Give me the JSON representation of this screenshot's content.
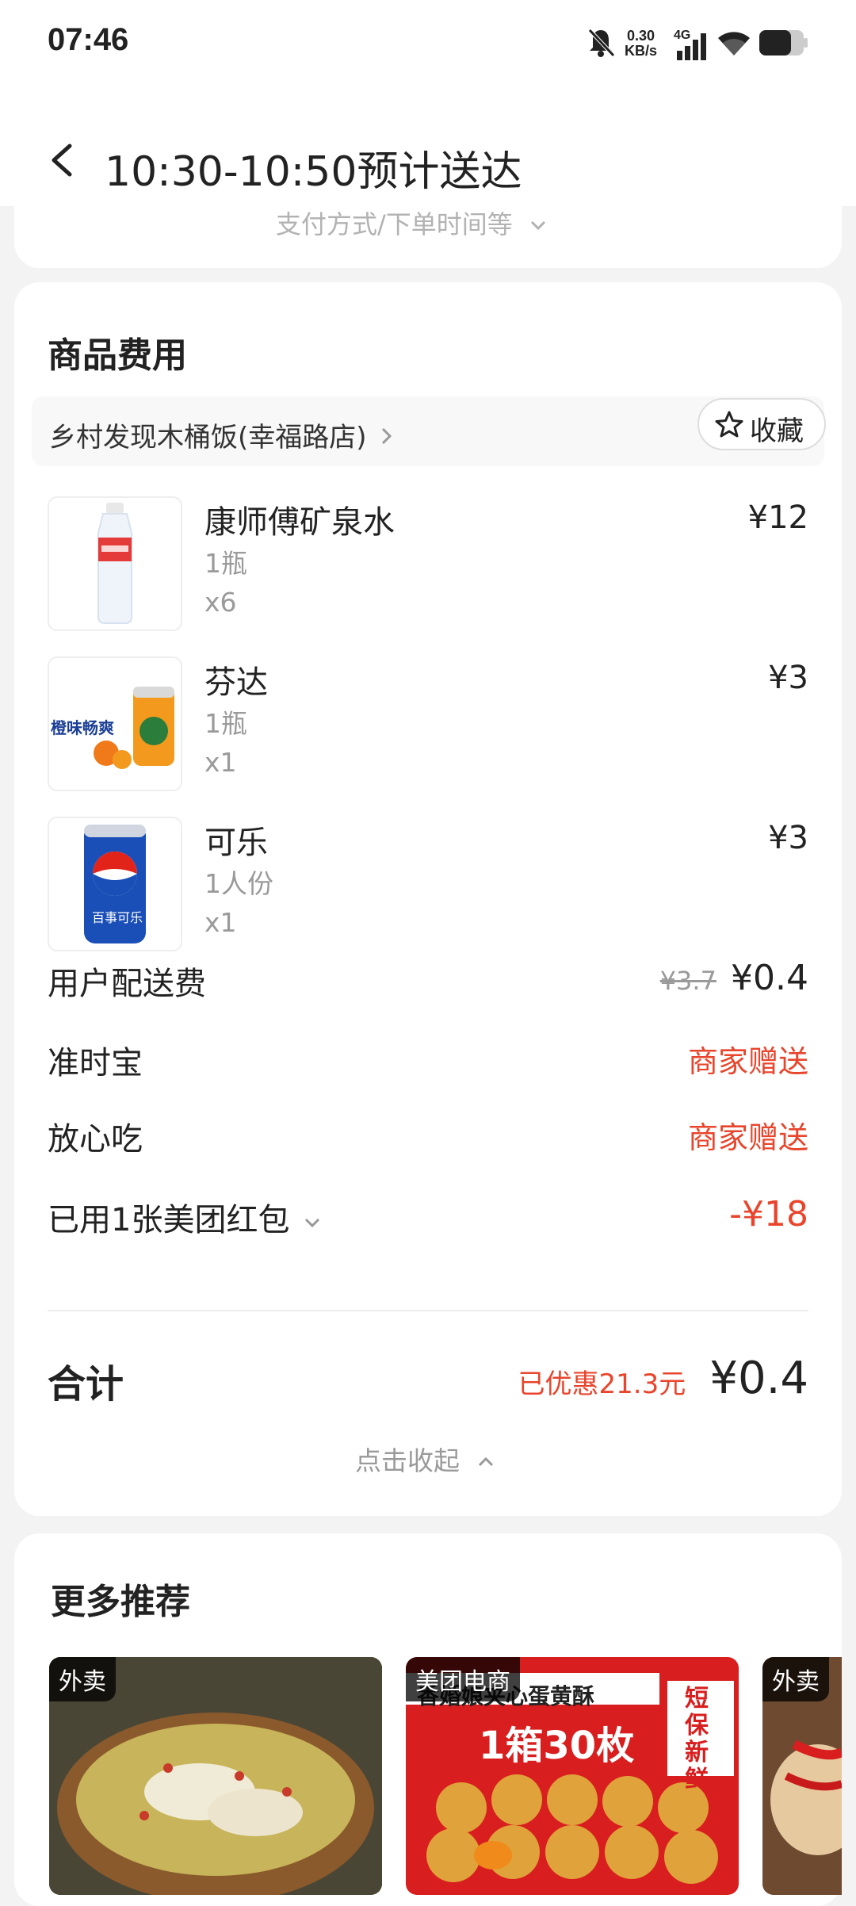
{
  "status_bar": {
    "time": "07:46",
    "net_speed_value": "0.30",
    "net_speed_unit": "KB/s",
    "network_type": "4G",
    "icons": [
      "bell-muted-icon",
      "signal-icon",
      "wifi-icon",
      "battery-icon"
    ]
  },
  "header": {
    "title": "10:30-10:50预计送达"
  },
  "top_card": {
    "hint": "支付方式/下单时间等"
  },
  "fees": {
    "title": "商品费用",
    "shop_name": "乡村发现木桶饭(幸福路店)",
    "favorite_label": "收藏",
    "items": [
      {
        "name": "康师傅矿泉水",
        "spec": "1瓶",
        "qty": "x6",
        "price": "¥12"
      },
      {
        "name": "芬达",
        "spec": "1瓶",
        "qty": "x1",
        "price": "¥3",
        "thumb_text": "橙味畅爽"
      },
      {
        "name": "可乐",
        "spec": "1人份",
        "qty": "x1",
        "price": "¥3",
        "thumb_text": "百事可乐"
      }
    ],
    "delivery": {
      "label": "用户配送费",
      "original": "¥3.7",
      "price": "¥0.4"
    },
    "ontime": {
      "label": "准时宝",
      "value": "商家赠送"
    },
    "safe": {
      "label": "放心吃",
      "value": "商家赠送"
    },
    "redpacket": {
      "label": "已用1张美团红包",
      "value": "-¥18"
    },
    "total": {
      "label": "合计",
      "discount": "已优惠21.3元",
      "amount": "¥0.4"
    },
    "collapse_label": "点击收起"
  },
  "more": {
    "title": "更多推荐",
    "cards": [
      {
        "tag": "外卖"
      },
      {
        "tag": "美团电商",
        "banner": "香婚娘夹心蛋黄酥",
        "headline": "1箱30枚",
        "side": "短保新鲜"
      },
      {
        "tag": "外卖"
      }
    ]
  },
  "colors": {
    "accent_red": "#e8452c",
    "text_primary": "#222222",
    "text_secondary": "#9a9a9a",
    "background": "#f3f3f3"
  }
}
